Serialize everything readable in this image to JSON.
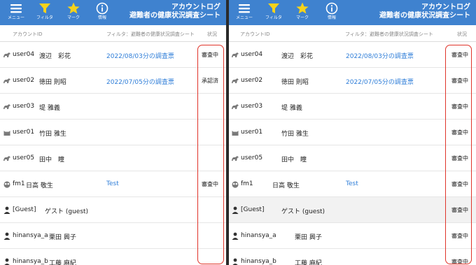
{
  "toolbar": {
    "menu_label": "メニュー",
    "filter_label": "フィルタ",
    "mark_label": "マーク",
    "info_label": "情報",
    "title_line1": "アカウントログ",
    "title_line2": "避難者の健康状況調査シート"
  },
  "columns": {
    "account_id": "アカウントID",
    "filter": "フィルタ：避難者の健康状況調査シート",
    "status": "状況"
  },
  "colors": {
    "header_bg": "#3f82cf",
    "link": "#2f7ed8",
    "highlight": "#e0342a",
    "filter_icon": "#f5d21b",
    "star_icon": "#f5d21b"
  },
  "left_rows": [
    {
      "user_id": "user04",
      "name": "渡辺　彩花",
      "survey": "2022/08/03分の調査票",
      "status": "審査中",
      "avatar": "horse-icon"
    },
    {
      "user_id": "user02",
      "name": "徳田 則昭",
      "survey": "2022/07/05分の調査票",
      "status": "承認済",
      "avatar": "elephant-icon"
    },
    {
      "user_id": "user03",
      "name": "堤 雅義",
      "survey": "",
      "status": "",
      "avatar": "cow-icon"
    },
    {
      "user_id": "user01",
      "name": "竹田 雅生",
      "survey": "",
      "status": "",
      "avatar": "cat-icon"
    },
    {
      "user_id": "user05",
      "name": "田中　瞳",
      "survey": "",
      "status": "",
      "avatar": "goat-icon"
    },
    {
      "user_id": "fm1",
      "name": "日高 敬生",
      "survey": "Test",
      "status": "審査中",
      "avatar": "owl-icon"
    },
    {
      "user_id": "[Guest]",
      "name": "ゲスト (guest)",
      "survey": "",
      "status": "",
      "avatar": "person-icon"
    },
    {
      "user_id": "hinansya_a",
      "name": "栗田 興子",
      "survey": "",
      "status": "",
      "avatar": "person-icon"
    },
    {
      "user_id": "hinansya_b",
      "name": "工藤 麻紀",
      "survey": "",
      "status": "",
      "avatar": "person-icon"
    }
  ],
  "right_rows": [
    {
      "user_id": "user04",
      "name": "渡辺　彩花",
      "survey": "2022/08/03分の調査票",
      "status": "審査中",
      "avatar": "horse-icon"
    },
    {
      "user_id": "user02",
      "name": "徳田 則昭",
      "survey": "2022/07/05分の調査票",
      "status": "審査中",
      "avatar": "elephant-icon"
    },
    {
      "user_id": "user03",
      "name": "堤 雅義",
      "survey": "",
      "status": "審査中",
      "avatar": "cow-icon"
    },
    {
      "user_id": "user01",
      "name": "竹田 雅生",
      "survey": "",
      "status": "審査中",
      "avatar": "cat-icon"
    },
    {
      "user_id": "user05",
      "name": "田中　瞳",
      "survey": "",
      "status": "審査中",
      "avatar": "goat-icon"
    },
    {
      "user_id": "fm1",
      "name": "日高 敬生",
      "survey": "Test",
      "status": "審査中",
      "avatar": "owl-icon"
    },
    {
      "user_id": "[Guest]",
      "name": "ゲスト (guest)",
      "survey": "",
      "status": "審査中",
      "avatar": "person-icon"
    },
    {
      "user_id": "hinansya_a",
      "name": "栗田 興子",
      "survey": "",
      "status": "審査中",
      "avatar": "person-icon"
    },
    {
      "user_id": "hinansya_b",
      "name": "工藤 麻紀",
      "survey": "",
      "status": "審査中",
      "avatar": "person-icon"
    }
  ]
}
